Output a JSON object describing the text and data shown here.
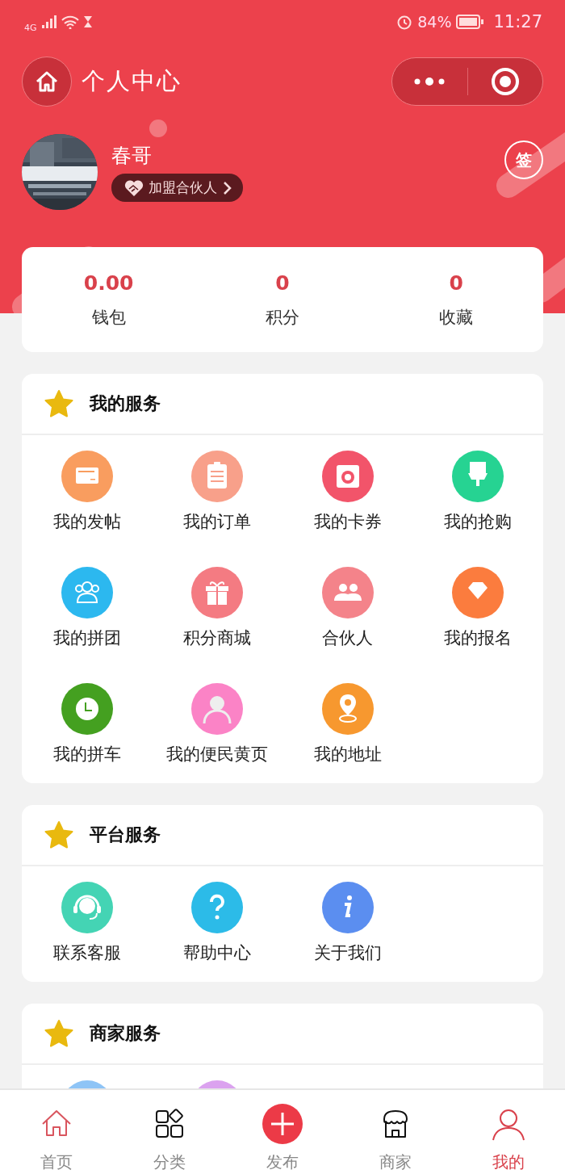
{
  "status_bar": {
    "network": "4G",
    "battery": "84%",
    "time": "11:27"
  },
  "nav": {
    "title": "个人中心"
  },
  "profile": {
    "name": "春哥",
    "partner_button": "加盟合伙人",
    "sign_button": "签"
  },
  "stats": [
    {
      "value": "0.00",
      "label": "钱包"
    },
    {
      "value": "0",
      "label": "积分"
    },
    {
      "value": "0",
      "label": "收藏"
    }
  ],
  "sections": [
    {
      "title": "我的服务",
      "items": [
        {
          "label": "我的发帖",
          "kind": "card",
          "color": "#f99d5f"
        },
        {
          "label": "我的订单",
          "kind": "clipboard",
          "color": "#f8a08a"
        },
        {
          "label": "我的卡券",
          "kind": "camera",
          "color": "#f2546a"
        },
        {
          "label": "我的抢购",
          "kind": "brush",
          "color": "#26d392"
        },
        {
          "label": "我的拼团",
          "kind": "group",
          "color": "#2cb8ef"
        },
        {
          "label": "积分商城",
          "kind": "gift",
          "color": "#f47b82"
        },
        {
          "label": "合伙人",
          "kind": "people",
          "color": "#f4838a"
        },
        {
          "label": "我的报名",
          "kind": "diamond",
          "color": "#fb7c3e"
        },
        {
          "label": "我的拼车",
          "kind": "clock",
          "color": "#44a020"
        },
        {
          "label": "我的便民黄页",
          "kind": "person",
          "color": "#fb83c6"
        },
        {
          "label": "我的地址",
          "kind": "pin",
          "color": "#f7982f"
        }
      ]
    },
    {
      "title": "平台服务",
      "items": [
        {
          "label": "联系客服",
          "kind": "headset",
          "color": "#44d4b4"
        },
        {
          "label": "帮助中心",
          "kind": "question",
          "color": "#2cbbe8"
        },
        {
          "label": "关于我们",
          "kind": "info",
          "color": "#5b8ef0"
        }
      ]
    },
    {
      "title": "商家服务",
      "items": [
        {
          "kind": "partial",
          "color": "#8ec4f6"
        },
        {
          "kind": "partial",
          "color": "#dba2ef"
        }
      ]
    }
  ],
  "tabs": [
    {
      "label": "首页",
      "kind": "home",
      "selected": false
    },
    {
      "label": "分类",
      "kind": "grid",
      "selected": false
    },
    {
      "label": "发布",
      "kind": "plus",
      "selected": false
    },
    {
      "label": "商家",
      "kind": "shop",
      "selected": false
    },
    {
      "label": "我的",
      "kind": "user",
      "selected": true
    }
  ]
}
